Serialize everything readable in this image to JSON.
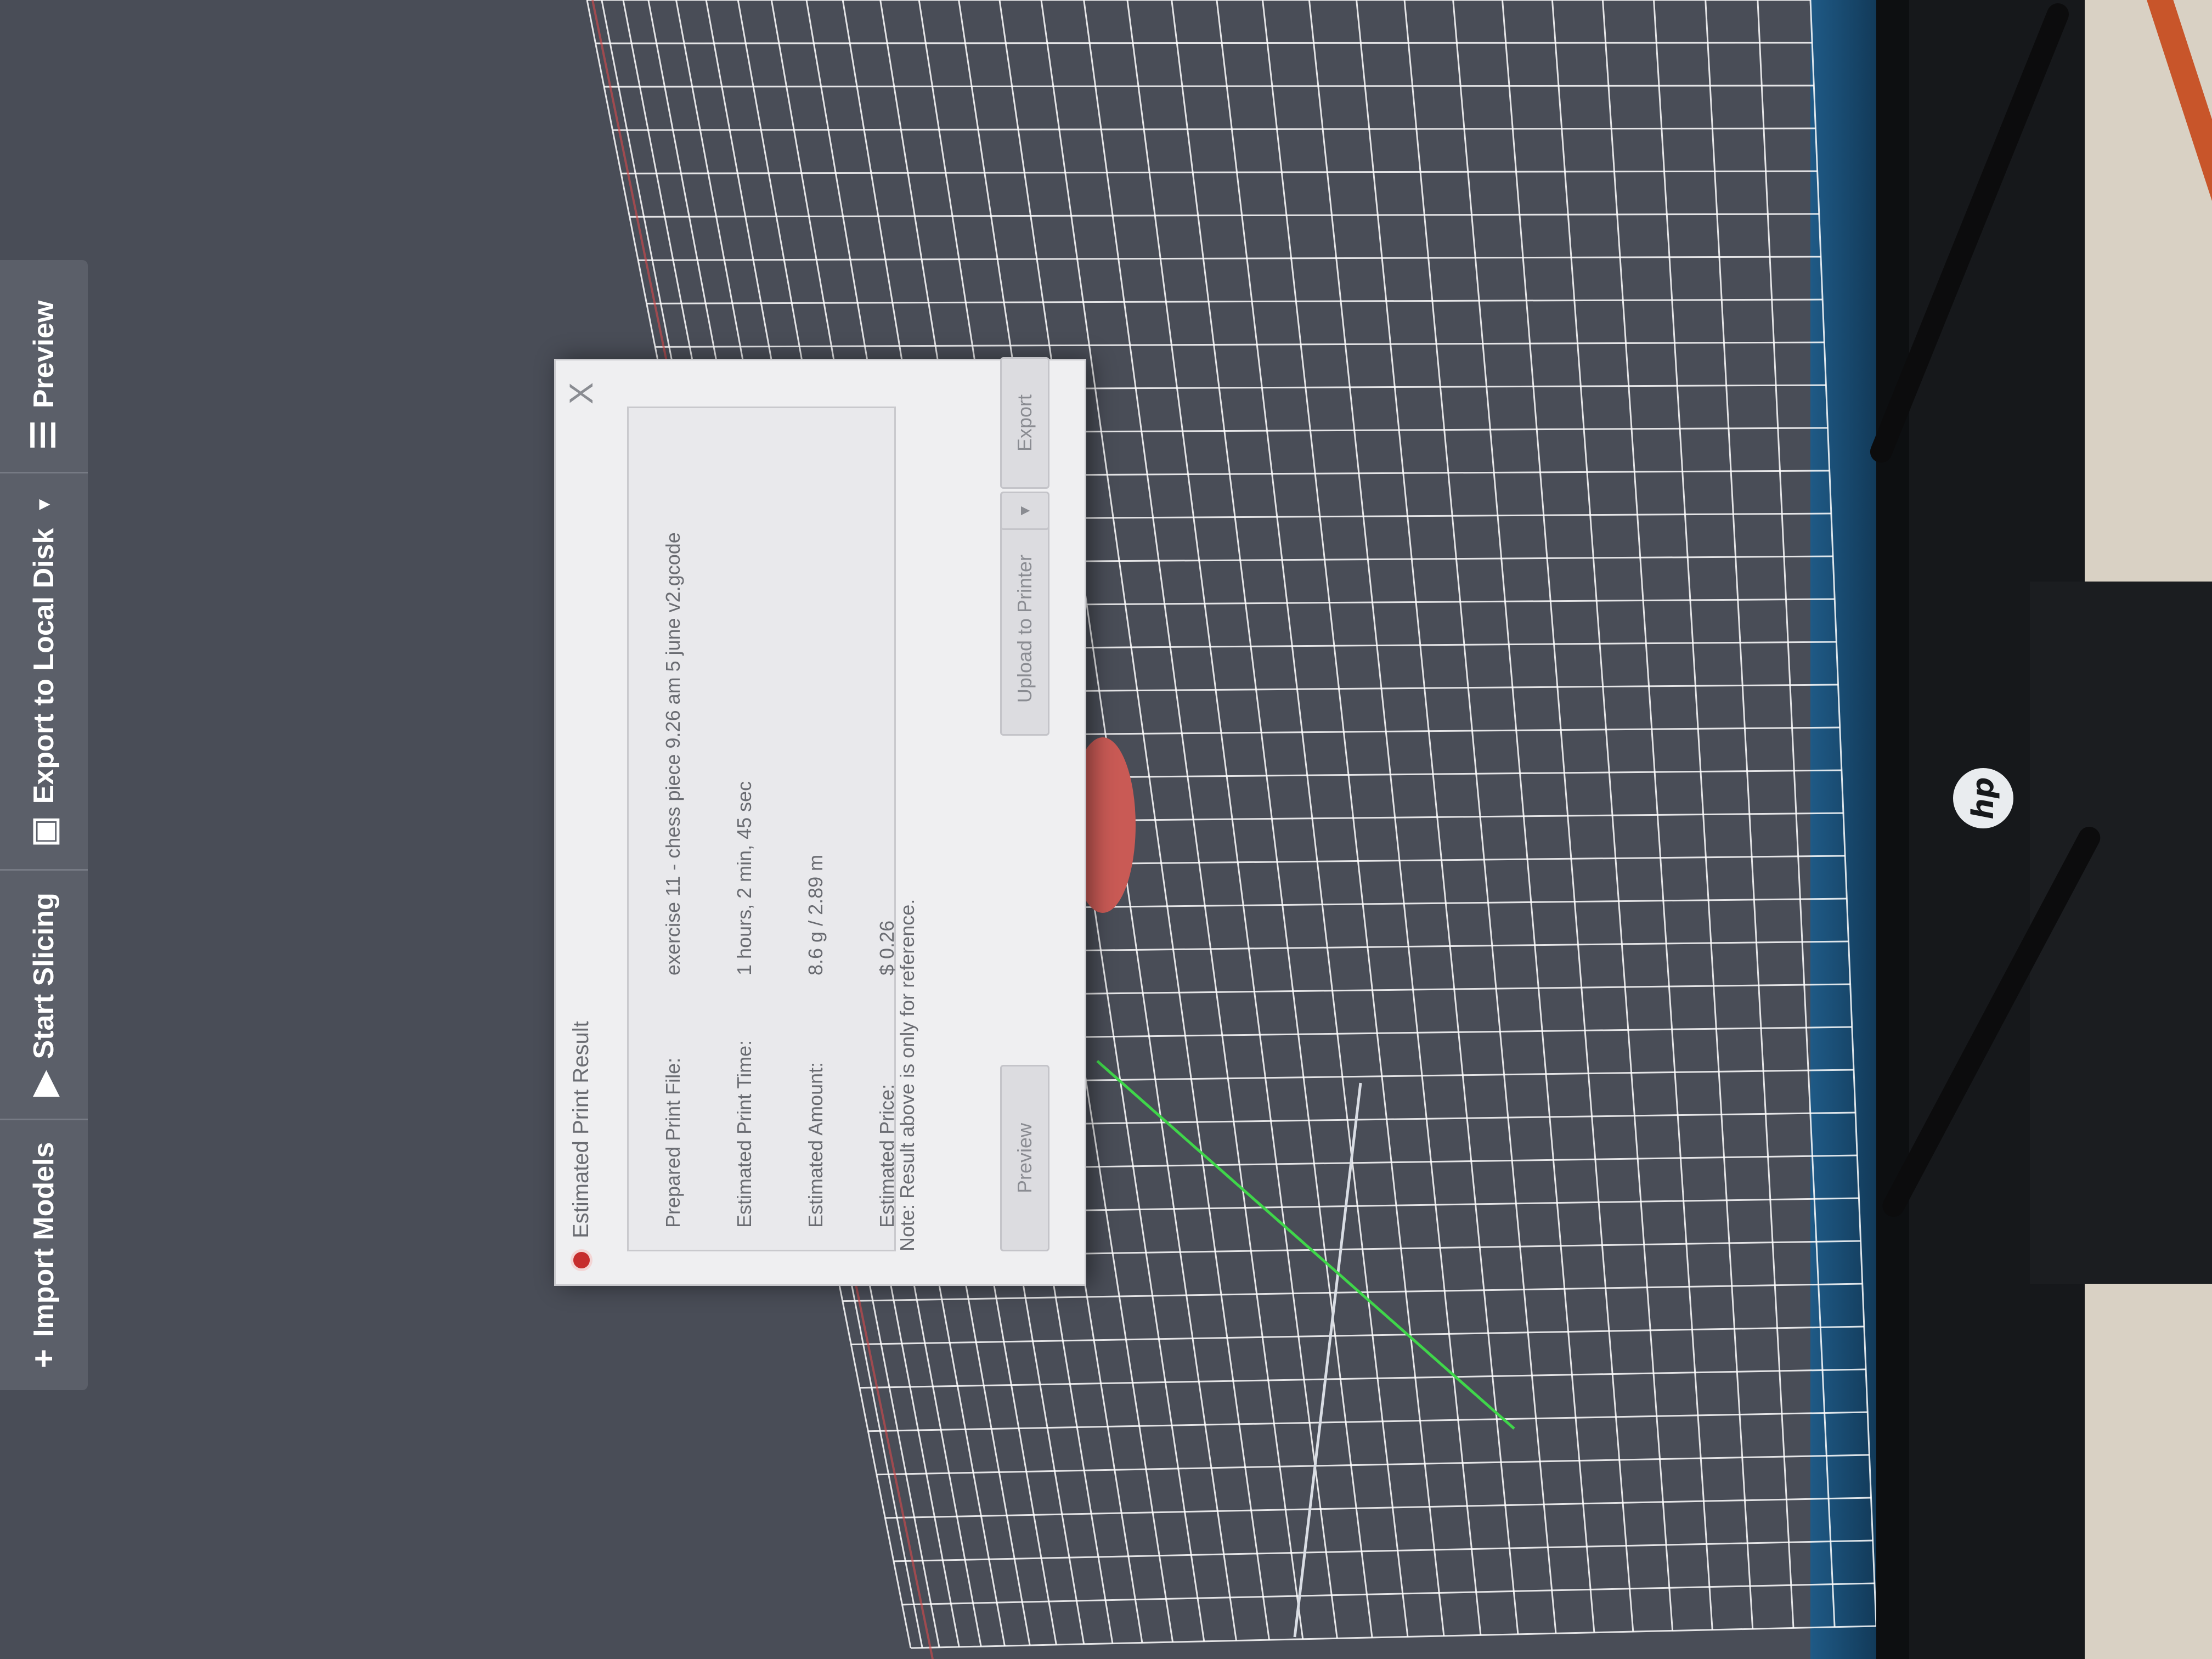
{
  "toolbar": {
    "import_label": "Import Models",
    "slice_label": "Start Slicing",
    "export_label": "Export to Local Disk",
    "preview_label": "Preview"
  },
  "dialog": {
    "title": "Estimated Print Result",
    "close_glyph": "X",
    "rows": [
      {
        "label": "Prepared Print File:",
        "value": "exercise 11 - chess piece 9.26 am 5 june v2.gcode"
      },
      {
        "label": "Estimated Print Time:",
        "value": "1 hours, 2 min, 45 sec"
      },
      {
        "label": "Estimated Amount:",
        "value": "8.6 g / 2.89 m"
      },
      {
        "label": "Estimated Price:",
        "value": "$ 0.26"
      }
    ],
    "note": "Note: Result above is only for reference.",
    "buttons": {
      "preview": "Preview",
      "upload": "Upload to Printer",
      "export": "Export"
    }
  },
  "monitor": {
    "brand": "hp"
  },
  "icons": {
    "import": "plus-icon",
    "slice": "play-circle-icon",
    "export": "disk-icon",
    "export_caret": "chevron-down-icon",
    "preview": "layers-icon",
    "app": "app-logo-icon",
    "close": "close-icon",
    "upload_caret": "chevron-down-icon"
  },
  "colors": {
    "background": "#494d57",
    "toolbar": "#5b5f69",
    "grid": "#ffffff",
    "axis_x": "#d84a4a",
    "axis_y": "#3fd64a"
  }
}
